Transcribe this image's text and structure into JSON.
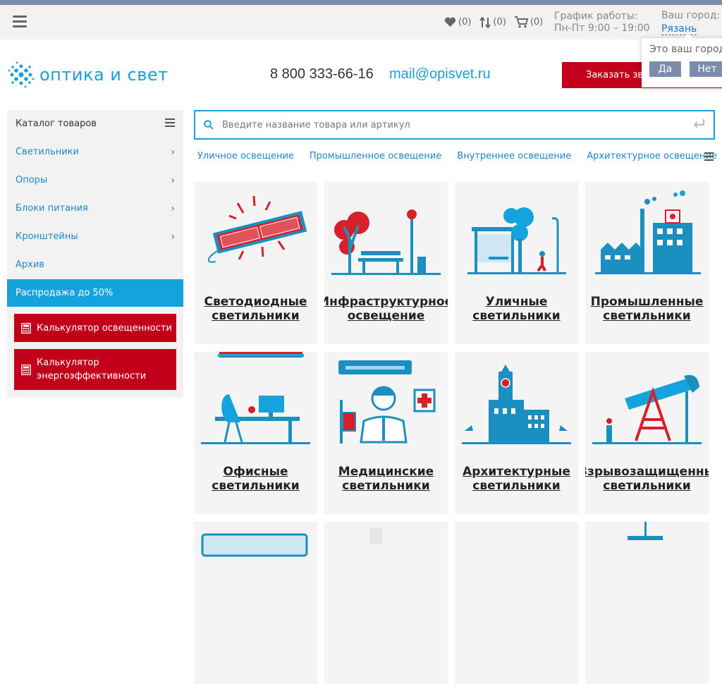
{
  "topbar": {
    "wishlist_count": "(0)",
    "compare_count": "(0)",
    "cart_count": "(0)",
    "schedule_label": "График работы:",
    "schedule_hours": "Пн-Пт 9:00 – 19:00",
    "city_label": "Ваш город:",
    "city_name": "Рязань"
  },
  "header": {
    "logo_text": "оптика и свет",
    "phone": "8 800 333-66-16",
    "email": "mail@opisvet.ru",
    "callback_label": "Заказать звонок"
  },
  "city_popup": {
    "question": "Это ваш город?",
    "yes_label": "Да",
    "no_label": "Нет"
  },
  "sidebar": {
    "title": "Каталог товаров",
    "items": [
      {
        "label": "Светильники"
      },
      {
        "label": "Опоры"
      },
      {
        "label": "Блоки питания"
      },
      {
        "label": "Кронштейны"
      },
      {
        "label": "Архив"
      }
    ],
    "sale_label": "Распродажа до 50%",
    "calc_light_label": "Калькулятор освещенности",
    "calc_energy_label_1": "Калькулятор",
    "calc_energy_label_2": "энергоэффективности"
  },
  "search": {
    "placeholder": "Введите название товара или артикул"
  },
  "categories": [
    "Уличное освещение",
    "Промышленное освещение",
    "Внутреннее освещение",
    "Архитектурное освещение"
  ],
  "cards": [
    {
      "line1": "Светодиодные",
      "line2": "светильники"
    },
    {
      "line1": "Инфраструктурное",
      "line2": "освещение"
    },
    {
      "line1": "Уличные",
      "line2": "светильники"
    },
    {
      "line1": "Промышленные",
      "line2": "светильники"
    },
    {
      "line1": "Офисные",
      "line2": "светильники"
    },
    {
      "line1": "Медицинские",
      "line2": "светильники"
    },
    {
      "line1": "Архитектурные",
      "line2": "светильники"
    },
    {
      "line1": "Взрывозащищенные",
      "line2": "светильники"
    }
  ],
  "colors": {
    "accent_blue": "#1aa0d8",
    "brand_red": "#c3001a",
    "link_blue": "#1e87c8",
    "stripe_gray": "#7b8cad"
  }
}
